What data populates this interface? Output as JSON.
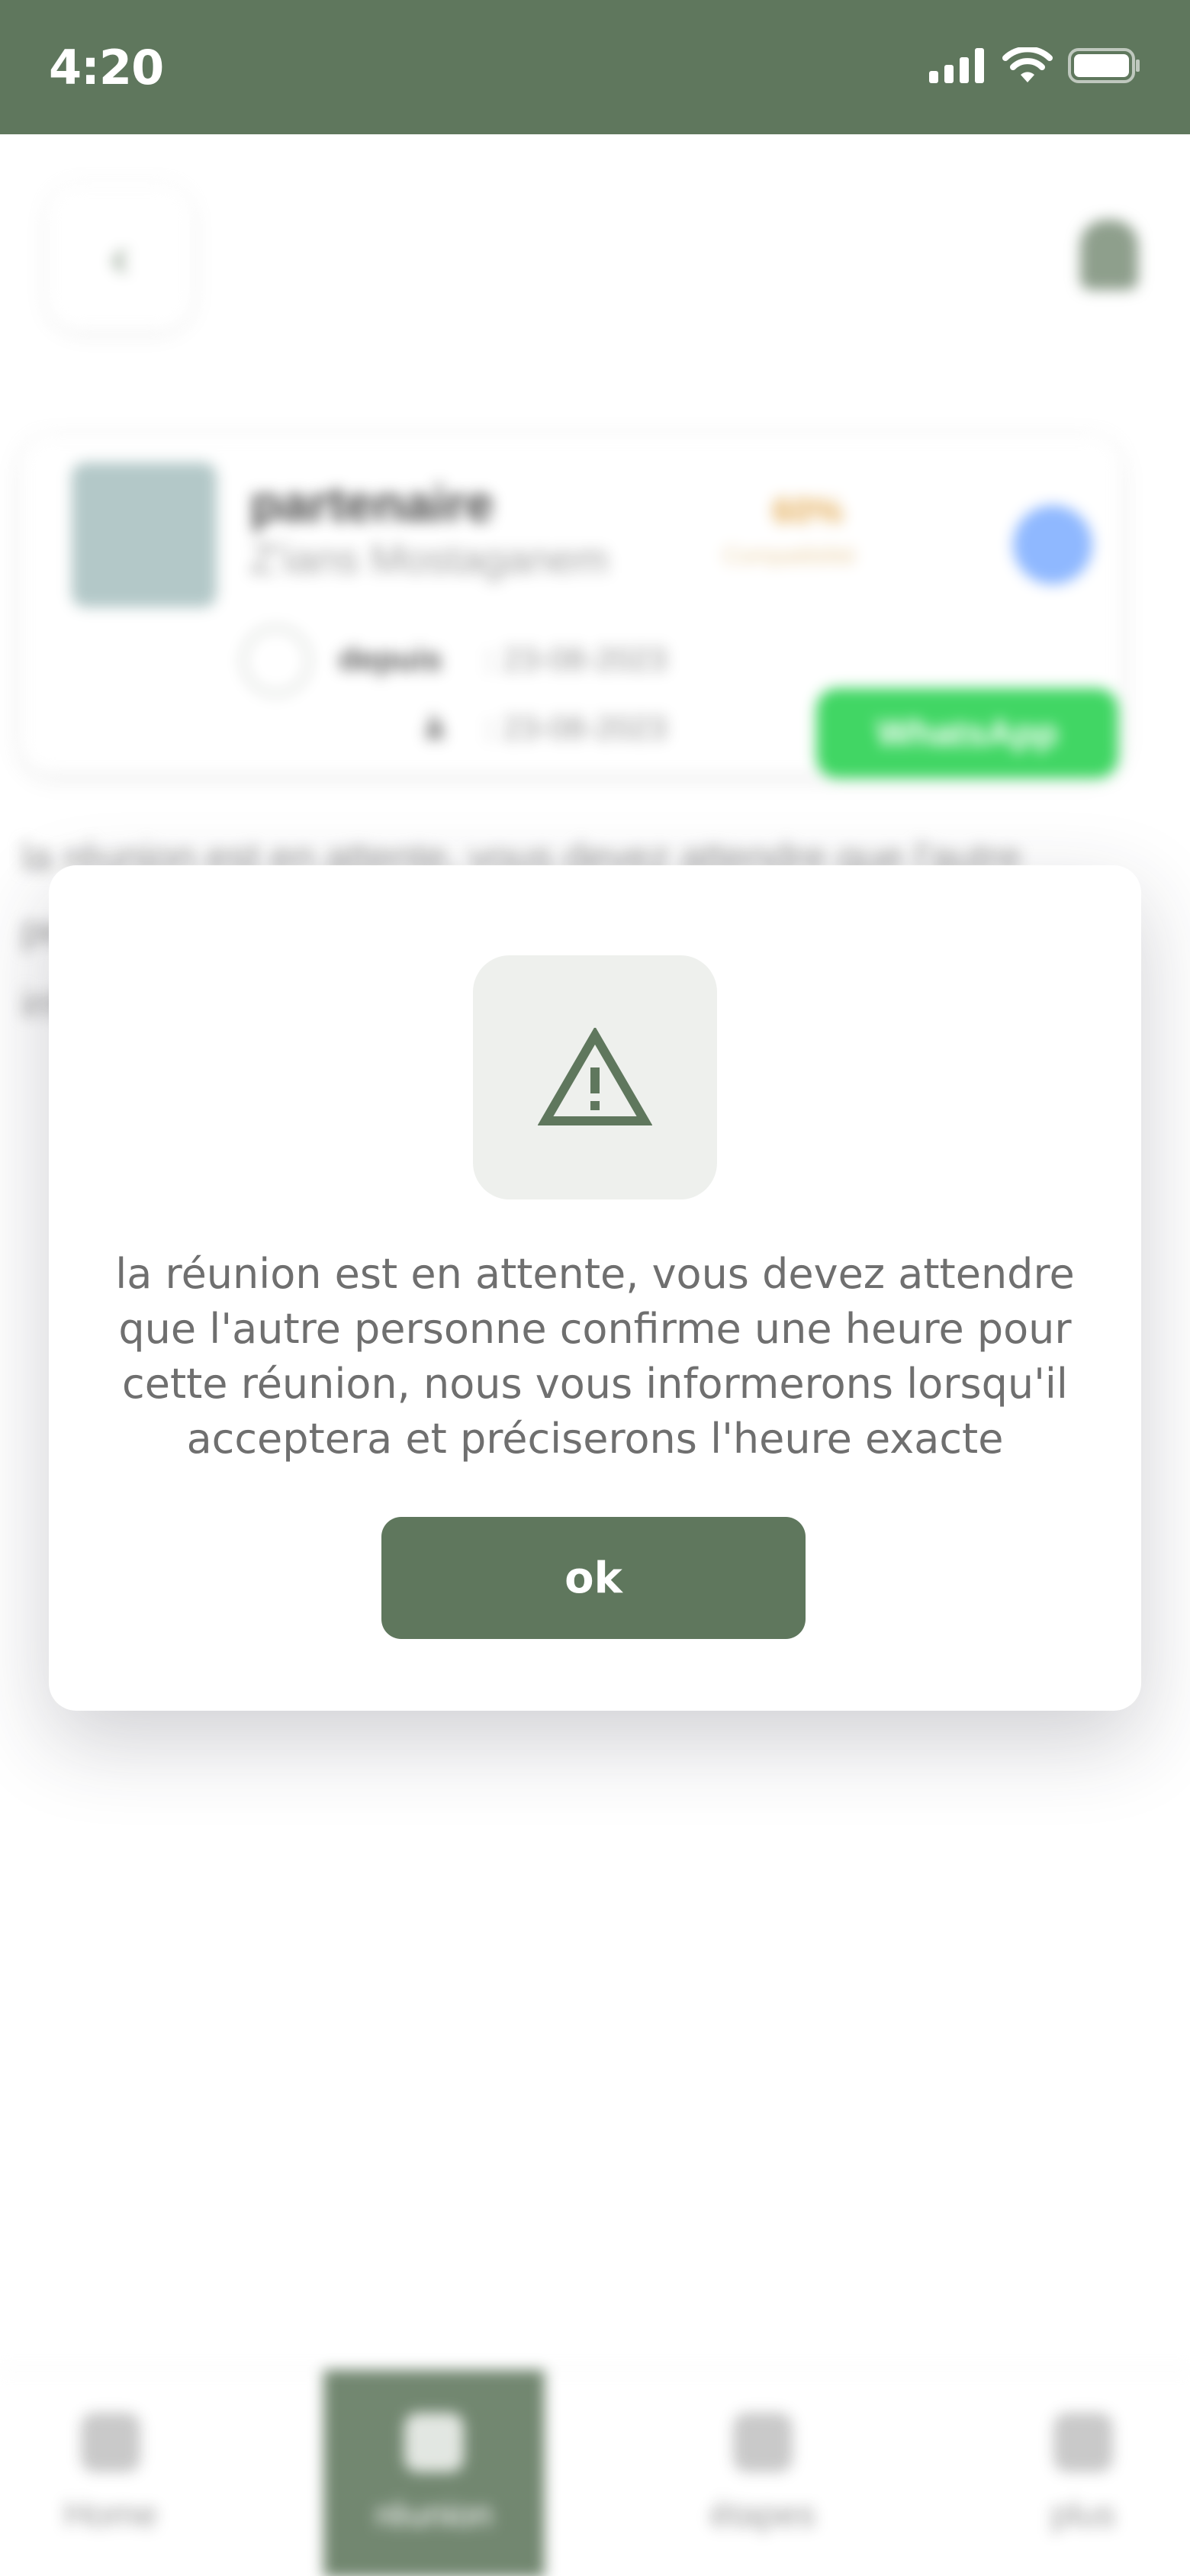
{
  "status_bar": {
    "time": "4:20",
    "icons": [
      "signal-icon",
      "wifi-icon",
      "battery-icon"
    ]
  },
  "background_page": {
    "partner": {
      "name": "partenaire",
      "city": "Z'ians Mostaganem",
      "score": "60%",
      "score_sub": "Compatibilité",
      "date_label": "depuis",
      "date_from": ": 23-08-2023",
      "date_to_label": "à",
      "date_to": ": 23-08-2023",
      "whatsapp_label": "WhatsApp"
    },
    "paragraph": "la réunion est en attente, vous devez attendre que l'autre personne confirme une heure pour cette réunion, nous vous informerons lorsqu'il acceptera et préciserons l'heure exacte"
  },
  "modal": {
    "icon": "warning-icon",
    "message": "la réunion est en attente, vous devez attendre que l'autre personne confirme une heure pour cette réunion, nous vous informerons lorsqu'il acceptera et préciserons l'heure exacte",
    "ok_label": "ok"
  },
  "bottom_nav": {
    "items": [
      {
        "label": "Home",
        "icon": "home-icon"
      },
      {
        "label": "réunion",
        "icon": "calendar-icon"
      },
      {
        "label": "étapes",
        "icon": "list-icon"
      },
      {
        "label": "plus",
        "icon": "gear-icon"
      }
    ]
  },
  "colors": {
    "primary": "#5f775d",
    "whatsapp": "#27d14f",
    "accent_score": "#e2a64a"
  }
}
